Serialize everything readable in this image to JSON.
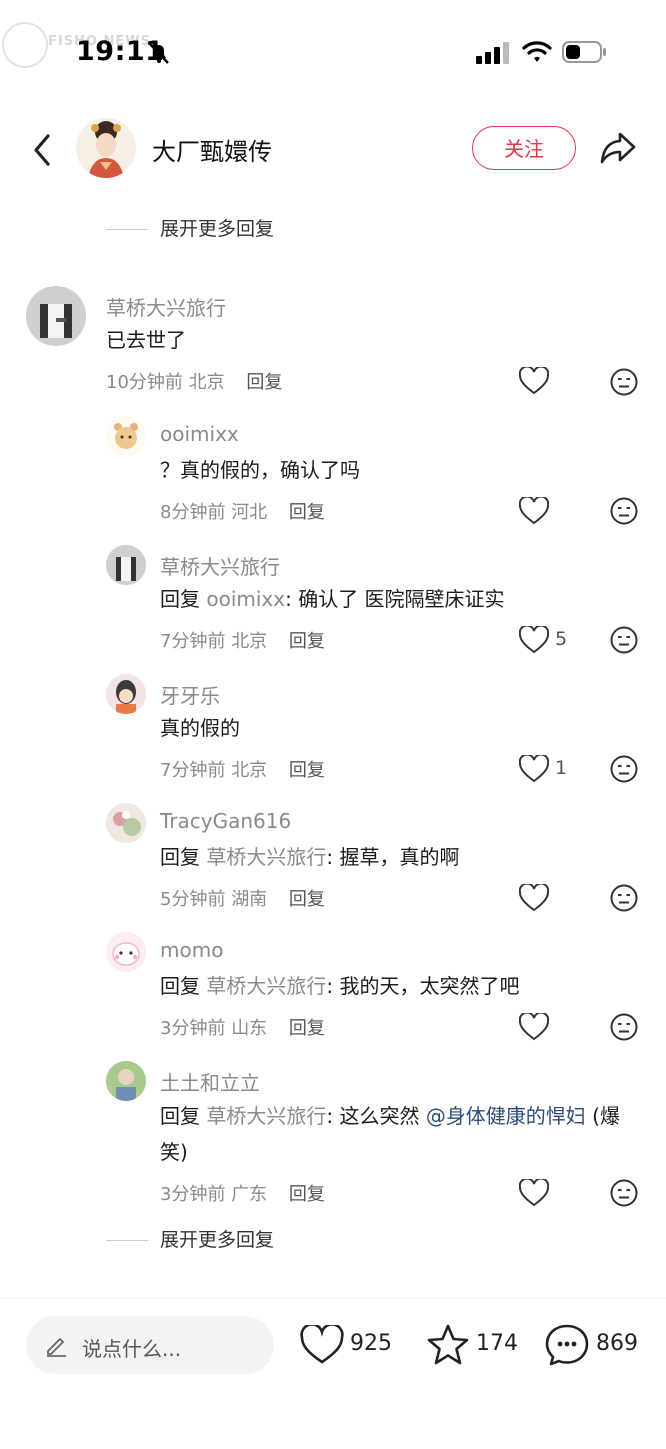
{
  "status": {
    "time": "19:11",
    "watermark": "FISHO NEWS"
  },
  "header": {
    "title": "大厂甄嬛传",
    "follow_label": "关注"
  },
  "expand_top": "展开更多回复",
  "expand_bottom": "展开更多回复",
  "comments": [
    {
      "name": "草桥大兴旅行",
      "text": "已去世了",
      "time": "10分钟前",
      "location": "北京",
      "reply_label": "回复",
      "likes": ""
    },
    {
      "name": "ooimixx",
      "text": "？真的假的，确认了吗",
      "time": "8分钟前",
      "location": "河北",
      "reply_label": "回复",
      "likes": ""
    },
    {
      "name": "草桥大兴旅行",
      "reply_prefix": "回复",
      "reply_to": "ooimixx",
      "text": ": 确认了 医院隔壁床证实",
      "time": "7分钟前",
      "location": "北京",
      "reply_label": "回复",
      "likes": "5"
    },
    {
      "name": "牙牙乐",
      "text": "真的假的",
      "time": "7分钟前",
      "location": "北京",
      "reply_label": "回复",
      "likes": "1"
    },
    {
      "name": "TracyGan616",
      "reply_prefix": "回复",
      "reply_to": "草桥大兴旅行",
      "text": ": 握草，真的啊",
      "time": "5分钟前",
      "location": "湖南",
      "reply_label": "回复",
      "likes": ""
    },
    {
      "name": "momo",
      "reply_prefix": "回复",
      "reply_to": "草桥大兴旅行",
      "text": ": 我的天，太突然了吧",
      "time": "3分钟前",
      "location": "山东",
      "reply_label": "回复",
      "likes": ""
    },
    {
      "name": "土土和立立",
      "reply_prefix": "回复",
      "reply_to": "草桥大兴旅行",
      "text": ": 这么突然 ",
      "mention": "@身体健康的悍妇",
      "text_tail": " (爆笑)",
      "time": "3分钟前",
      "location": "广东",
      "reply_label": "回复",
      "likes": ""
    }
  ],
  "bottom": {
    "placeholder": "说点什么...",
    "likes": "925",
    "stars": "174",
    "comments": "869"
  },
  "colors": {
    "accent": "#e2364b",
    "mention": "#2e4b7a",
    "muted": "#8a8a8a"
  }
}
